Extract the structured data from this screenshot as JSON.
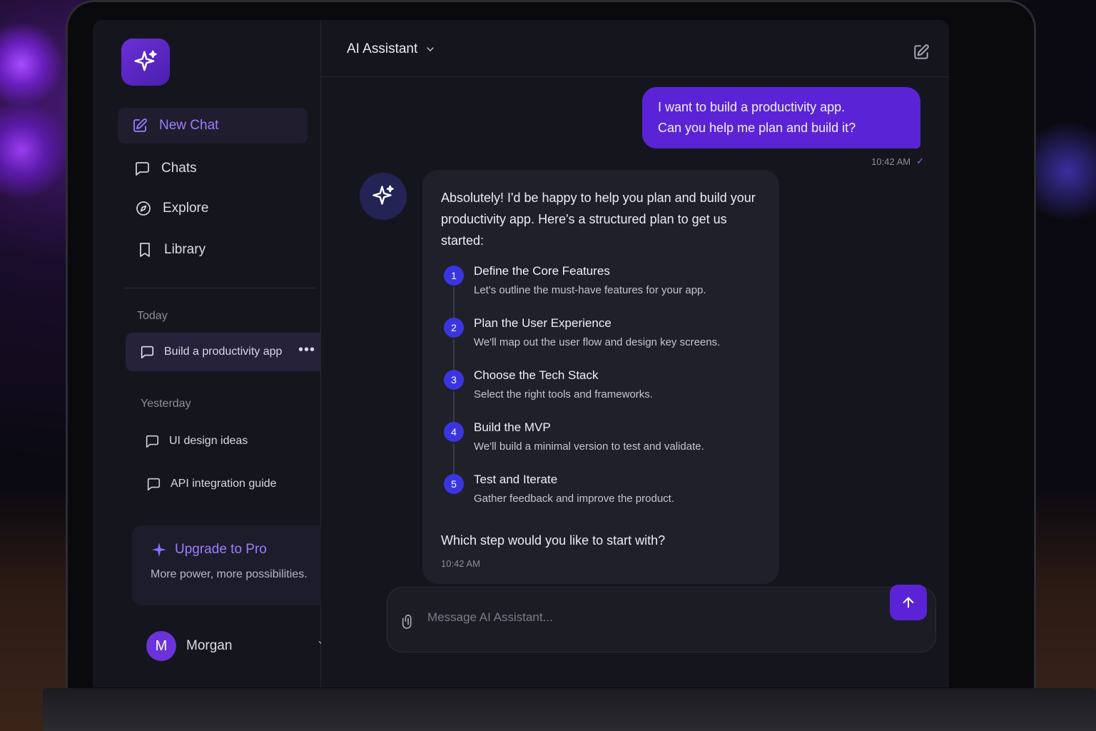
{
  "sidebar": {
    "nav": [
      {
        "label": "New Chat",
        "icon": "compose-icon"
      },
      {
        "label": "Chats",
        "icon": "chat-bubble-icon"
      },
      {
        "label": "Explore",
        "icon": "compass-icon"
      },
      {
        "label": "Library",
        "icon": "bookmark-icon"
      }
    ],
    "today_label": "Today",
    "today_chats": [
      {
        "label": "Build a productivity app"
      }
    ],
    "yesterday_label": "Yesterday",
    "yesterday_chats": [
      {
        "label": "UI design ideas"
      },
      {
        "label": "API integration guide"
      }
    ],
    "upgrade": {
      "title": "Upgrade to Pro",
      "subtitle": "More power, more possibilities."
    },
    "user": {
      "initial": "M",
      "name": "Morgan"
    }
  },
  "header": {
    "title": "AI Assistant"
  },
  "messages": {
    "user": {
      "line1": "I want to build a productivity app.",
      "line2": "Can you help me plan and build it?",
      "time": "10:42 AM"
    },
    "assistant": {
      "intro": "Absolutely! I'd be happy to help you plan and build your productivity app. Here's a structured plan to get us started:",
      "steps": [
        {
          "num": "1",
          "title": "Define the Core Features",
          "desc": "Let's outline the must-have features for your app."
        },
        {
          "num": "2",
          "title": "Plan the User Experience",
          "desc": "We'll map out the user flow and design key screens."
        },
        {
          "num": "3",
          "title": "Choose the Tech Stack",
          "desc": "Select the right tools and frameworks."
        },
        {
          "num": "4",
          "title": "Build the MVP",
          "desc": "We'll build a minimal version to test and validate."
        },
        {
          "num": "5",
          "title": "Test and Iterate",
          "desc": "Gather feedback and improve the product."
        }
      ],
      "outro": "Which step would you like to start with?",
      "time": "10:42 AM"
    }
  },
  "composer": {
    "placeholder": "Message AI Assistant..."
  },
  "colors": {
    "accent": "#5a24d6",
    "accent_text": "#9d7dff",
    "background": "#15161d",
    "step_badge": "#3b35e0"
  }
}
